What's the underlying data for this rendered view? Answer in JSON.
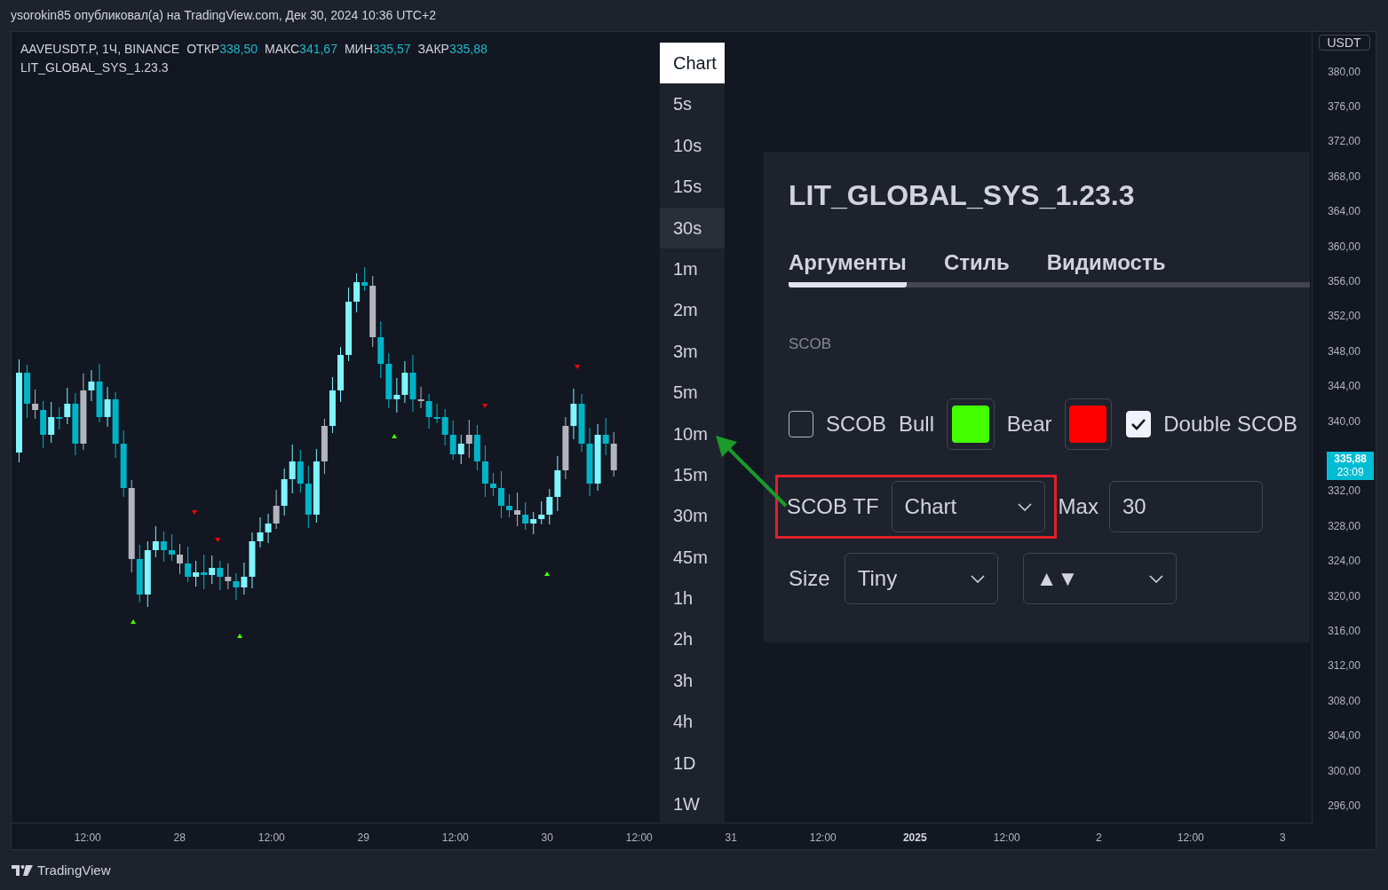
{
  "header": {
    "text": "ysorokin85 опубликовал(а) на TradingView.com, Дек 30, 2024 10:36 UTC+2"
  },
  "legend": {
    "symbol": "AAVEUSDT.P, 1Ч, BINANCE",
    "ohlc": [
      {
        "label": "ОТКР",
        "value": "338,50"
      },
      {
        "label": "МАКС",
        "value": "341,67"
      },
      {
        "label": "МИН",
        "value": "335,57"
      },
      {
        "label": "ЗАКР",
        "value": "335,88"
      }
    ],
    "indicator": "LIT_GLOBAL_SYS_1.23.3"
  },
  "price_axis": {
    "currency": "USDT",
    "labels": [
      {
        "kind": "tick",
        "text": "380,00"
      },
      {
        "kind": "tick",
        "text": "376,00"
      },
      {
        "kind": "tick",
        "text": "372,00"
      },
      {
        "kind": "tick",
        "text": "368,00"
      },
      {
        "kind": "tick",
        "text": "364,00"
      },
      {
        "kind": "tick",
        "text": "360,00"
      },
      {
        "kind": "tick",
        "text": "356,00"
      },
      {
        "kind": "tick",
        "text": "352,00"
      },
      {
        "kind": "tick",
        "text": "348,00"
      },
      {
        "kind": "tick",
        "text": "344,00"
      },
      {
        "kind": "tick",
        "text": "340,00"
      },
      {
        "kind": "current",
        "price": "335,88",
        "countdown": "23:09"
      },
      {
        "kind": "tick",
        "text": "332,00"
      },
      {
        "kind": "tick",
        "text": "328,00"
      },
      {
        "kind": "tick",
        "text": "324,00"
      },
      {
        "kind": "tick",
        "text": "320,00"
      },
      {
        "kind": "tick",
        "text": "316,00"
      },
      {
        "kind": "tick",
        "text": "312,00"
      },
      {
        "kind": "tick",
        "text": "308,00"
      },
      {
        "kind": "tick",
        "text": "304,00"
      },
      {
        "kind": "tick",
        "text": "300,00"
      },
      {
        "kind": "tick",
        "text": "296,00"
      }
    ]
  },
  "time_axis": [
    {
      "kind": "time",
      "text": "12:00"
    },
    {
      "kind": "day",
      "text": "28"
    },
    {
      "kind": "time",
      "text": "12:00"
    },
    {
      "kind": "day",
      "text": "29"
    },
    {
      "kind": "time",
      "text": "12:00"
    },
    {
      "kind": "day",
      "text": "30"
    },
    {
      "kind": "time",
      "text": "12:00"
    },
    {
      "kind": "day",
      "text": "31"
    },
    {
      "kind": "time",
      "text": "12:00"
    },
    {
      "kind": "year",
      "text": "2025"
    },
    {
      "kind": "time",
      "text": "12:00"
    },
    {
      "kind": "day",
      "text": "2"
    },
    {
      "kind": "time",
      "text": "12:00"
    },
    {
      "kind": "day",
      "text": "3"
    }
  ],
  "timeframe_menu": [
    {
      "label": "Chart",
      "selected": true,
      "hovered": false
    },
    {
      "label": "5s",
      "selected": false,
      "hovered": false
    },
    {
      "label": "10s",
      "selected": false,
      "hovered": false
    },
    {
      "label": "15s",
      "selected": false,
      "hovered": false
    },
    {
      "label": "30s",
      "selected": false,
      "hovered": true
    },
    {
      "label": "1m",
      "selected": false,
      "hovered": false
    },
    {
      "label": "2m",
      "selected": false,
      "hovered": false
    },
    {
      "label": "3m",
      "selected": false,
      "hovered": false
    },
    {
      "label": "5m",
      "selected": false,
      "hovered": false
    },
    {
      "label": "10m",
      "selected": false,
      "hovered": false
    },
    {
      "label": "15m",
      "selected": false,
      "hovered": false
    },
    {
      "label": "30m",
      "selected": false,
      "hovered": false
    },
    {
      "label": "45m",
      "selected": false,
      "hovered": false
    },
    {
      "label": "1h",
      "selected": false,
      "hovered": false
    },
    {
      "label": "2h",
      "selected": false,
      "hovered": false
    },
    {
      "label": "3h",
      "selected": false,
      "hovered": false
    },
    {
      "label": "4h",
      "selected": false,
      "hovered": false
    },
    {
      "label": "1D",
      "selected": false,
      "hovered": false
    },
    {
      "label": "1W",
      "selected": false,
      "hovered": false
    }
  ],
  "settings": {
    "title": "LIT_GLOBAL_SYS_1.23.3",
    "tabs": [
      {
        "label": "Аргументы",
        "selected": true
      },
      {
        "label": "Стиль",
        "selected": false
      },
      {
        "label": "Видимость",
        "selected": false
      }
    ],
    "section": "SCOB",
    "rows": [
      [
        {
          "kind": "checkbox",
          "label": "SCOB",
          "checked": false
        },
        {
          "kind": "label",
          "text": "Bull"
        },
        {
          "kind": "swatch",
          "color": "#44ff00"
        },
        {
          "kind": "label",
          "text": "Bear"
        },
        {
          "kind": "swatch",
          "color": "#ff0000"
        },
        {
          "kind": "checkbox",
          "label": "Double SCOB",
          "checked": true
        }
      ],
      [
        {
          "kind": "label",
          "text": "SCOB TF",
          "highlighted": true
        },
        {
          "kind": "select",
          "value": "Chart",
          "highlighted": true
        },
        {
          "kind": "label",
          "text": "Max"
        },
        {
          "kind": "input",
          "value": "30"
        }
      ],
      [
        {
          "kind": "label",
          "text": "Size"
        },
        {
          "kind": "select",
          "value": "Tiny"
        },
        {
          "kind": "select",
          "value": "▲▼"
        }
      ]
    ]
  },
  "footer": {
    "brand": "TradingView"
  }
}
